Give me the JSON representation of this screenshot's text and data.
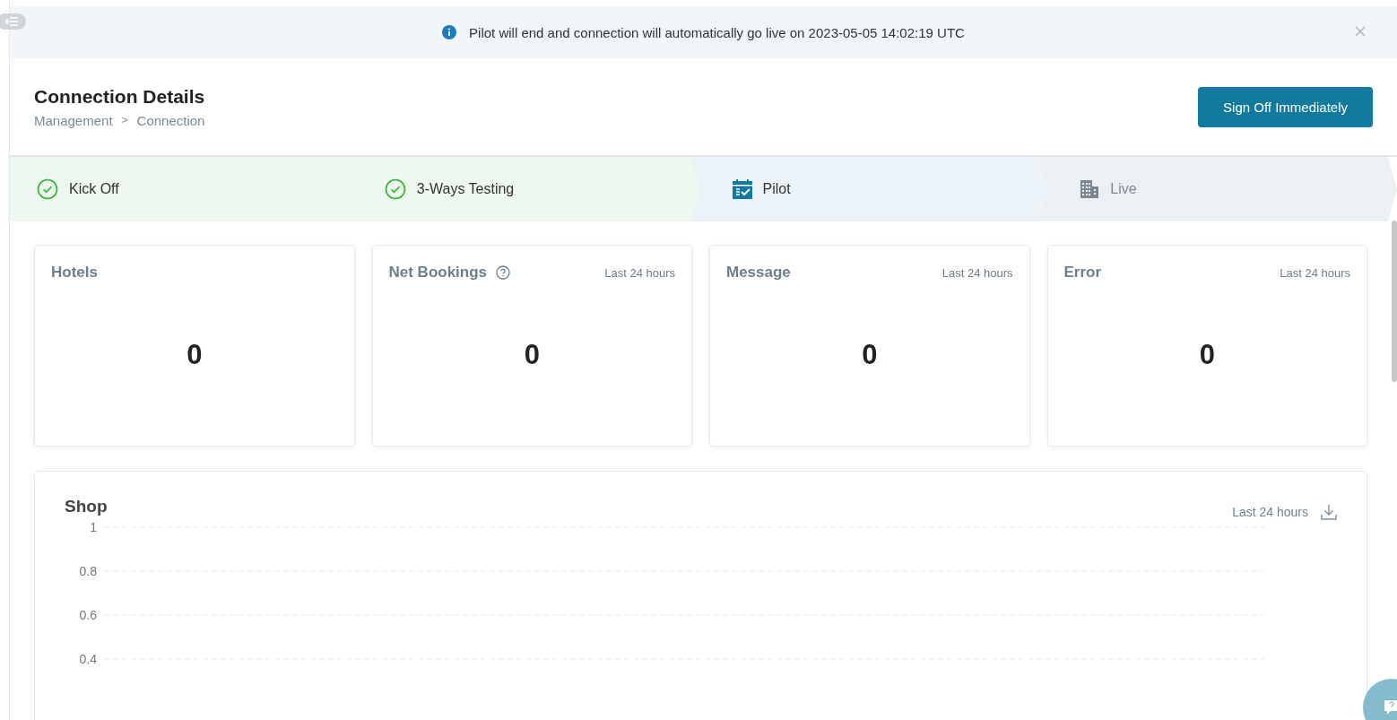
{
  "banner": {
    "message": "Pilot will end and connection will automatically go live on 2023-05-05 14:02:19 UTC"
  },
  "header": {
    "title": "Connection Details",
    "breadcrumb": [
      "Management",
      "Connection"
    ],
    "breadcrumb_separator": ">",
    "action": "Sign Off Immediately"
  },
  "steps": [
    {
      "kind": "done",
      "label": "Kick Off"
    },
    {
      "kind": "done",
      "label": "3-Ways Testing"
    },
    {
      "kind": "current",
      "label": "Pilot"
    },
    {
      "kind": "pending",
      "label": "Live"
    }
  ],
  "stats": [
    {
      "title": "Hotels",
      "value": "0"
    },
    {
      "title": "Net Bookings",
      "help": true,
      "period": "Last 24 hours",
      "value": "0"
    },
    {
      "title": "Message",
      "period": "Last 24 hours",
      "value": "0"
    },
    {
      "title": "Error",
      "period": "Last 24 hours",
      "value": "0"
    }
  ],
  "chart_panel": {
    "title": "Shop",
    "period": "Last 24 hours",
    "y_axis_labels": [
      "1",
      "0.8",
      "0.6",
      "0.4"
    ]
  }
}
